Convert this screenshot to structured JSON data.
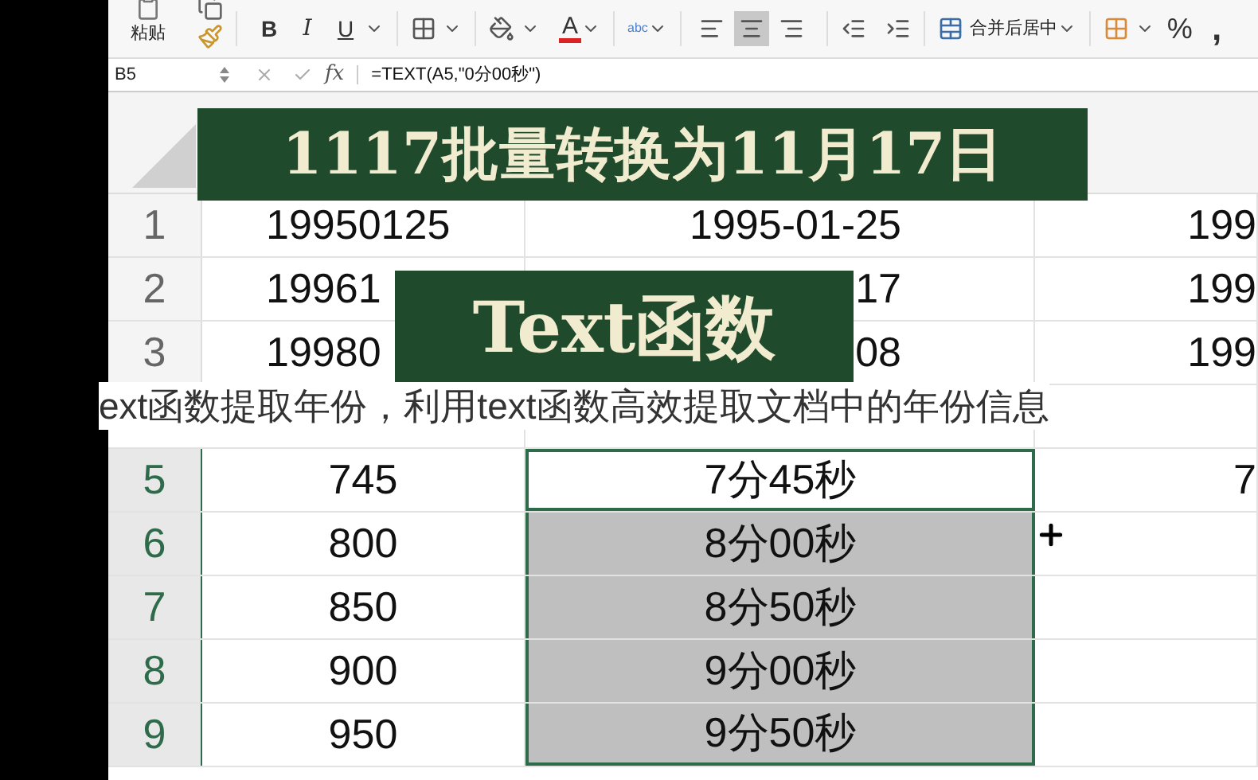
{
  "toolbar": {
    "paste_label": "粘贴",
    "format_buttons": [
      "B",
      "I",
      "U"
    ],
    "font_color_label": "A",
    "text_style_label": "abc",
    "alignment": [
      {
        "selected": false
      },
      {
        "selected": true
      },
      {
        "selected": false
      }
    ],
    "merge_label": "合并后居中",
    "percent_label": "%",
    "comma_label": ","
  },
  "formula_bar": {
    "cell_name": "B5",
    "fx_label": "fx",
    "formula": "=TEXT(A5,\"0分00秒\")"
  },
  "rows": [
    {
      "header": "1",
      "kind": "dates",
      "selected": false,
      "active": false,
      "cells": [
        "19950125",
        "1995-01-25",
        "199"
      ]
    },
    {
      "header": "2",
      "kind": "dates",
      "selected": false,
      "active": false,
      "cells": [
        "19961",
        "17",
        "199"
      ]
    },
    {
      "header": "3",
      "kind": "dates",
      "selected": false,
      "active": false,
      "cells": [
        "19980",
        "08",
        "199"
      ]
    },
    {
      "header": "",
      "kind": "dates",
      "selected": false,
      "active": false,
      "cells": [
        "",
        "",
        ""
      ]
    },
    {
      "header": "5",
      "kind": "times",
      "selected": true,
      "active": true,
      "cells": [
        "745",
        "7分45秒",
        "7"
      ]
    },
    {
      "header": "6",
      "kind": "times",
      "selected": true,
      "active": false,
      "cells": [
        "800",
        "8分00秒",
        ""
      ]
    },
    {
      "header": "7",
      "kind": "times",
      "selected": true,
      "active": false,
      "cells": [
        "850",
        "8分50秒",
        ""
      ]
    },
    {
      "header": "8",
      "kind": "times",
      "selected": true,
      "active": false,
      "cells": [
        "900",
        "9分00秒",
        ""
      ]
    },
    {
      "header": "9",
      "kind": "times",
      "selected": true,
      "active": false,
      "cells": [
        "950",
        "9分50秒",
        ""
      ]
    }
  ],
  "overlays": {
    "title_banner": "1117批量转换为11月17日",
    "topic_banner": "Text函数",
    "caption": "ext函数提取年份，利用text函数高效提取文档中的年份信息"
  }
}
